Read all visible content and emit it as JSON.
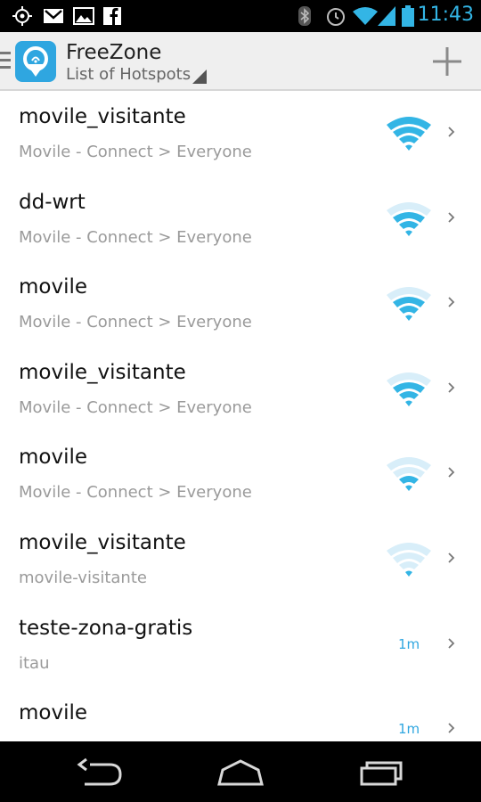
{
  "status_bar": {
    "time": "11:43",
    "left_icons": [
      "gps-icon",
      "gmail-icon",
      "gallery-icon",
      "facebook-icon"
    ],
    "right_icons": [
      "bluetooth-icon",
      "alarm-icon",
      "wifi-status-icon",
      "signal-icon",
      "battery-icon"
    ]
  },
  "action_bar": {
    "title": "FreeZone",
    "subtitle": "List of Hotspots"
  },
  "colors": {
    "accent": "#33b5e5",
    "app_blue": "#2fa6e0",
    "status_bg": "#000000",
    "action_bar_bg": "#efefef"
  },
  "hotspots": [
    {
      "name": "movile_visitante",
      "detail": "Movile - Connect > Everyone",
      "signal": 4,
      "distance": ""
    },
    {
      "name": "dd-wrt",
      "detail": "Movile - Connect > Everyone",
      "signal": 3,
      "distance": ""
    },
    {
      "name": "movile",
      "detail": "Movile - Connect > Everyone",
      "signal": 3,
      "distance": ""
    },
    {
      "name": "movile_visitante",
      "detail": "Movile - Connect > Everyone",
      "signal": 3,
      "distance": ""
    },
    {
      "name": "movile",
      "detail": "Movile - Connect > Everyone",
      "signal": 2,
      "distance": ""
    },
    {
      "name": "movile_visitante",
      "detail": "movile-visitante",
      "signal": 1,
      "distance": ""
    },
    {
      "name": "teste-zona-gratis",
      "detail": "itau",
      "signal": 0,
      "distance": "1m"
    },
    {
      "name": "movile",
      "detail": "",
      "signal": 0,
      "distance": "1m"
    }
  ],
  "nav_bar": {
    "buttons": [
      "back-icon",
      "home-icon",
      "recent-apps-icon"
    ]
  }
}
